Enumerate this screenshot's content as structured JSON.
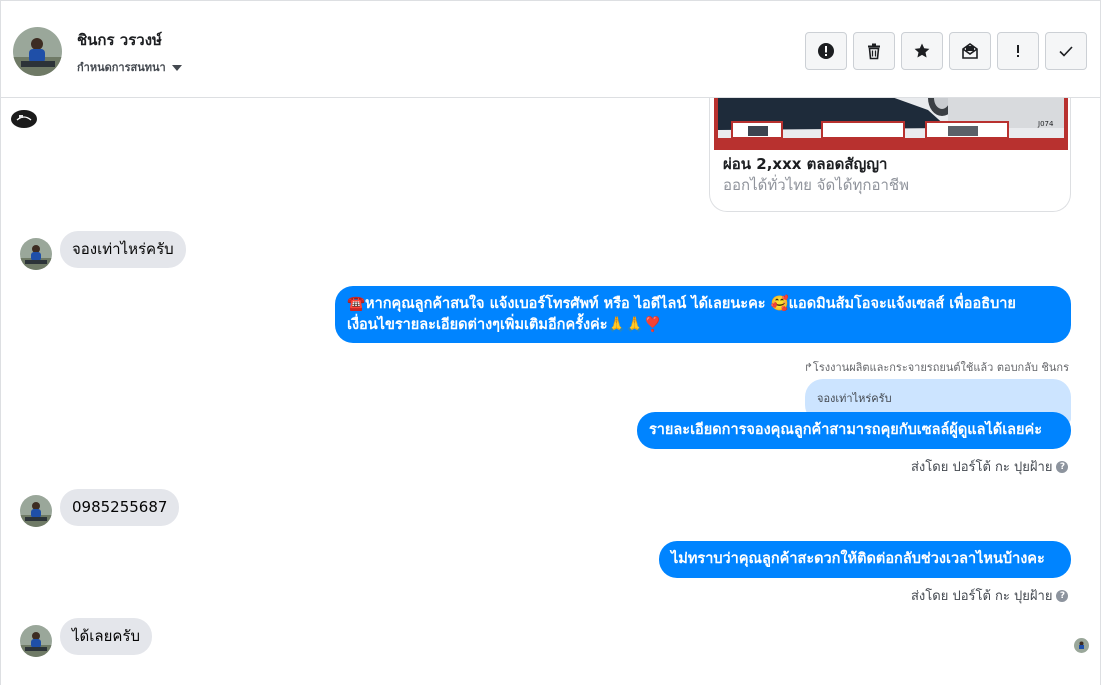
{
  "header": {
    "name": "ชินกร วรวงษ์",
    "subtitle": "กำหนดการสนทนา"
  },
  "actions": [
    {
      "name": "report-icon",
      "glyph": "!"
    },
    {
      "name": "trash-icon",
      "glyph": ""
    },
    {
      "name": "star-icon",
      "glyph": ""
    },
    {
      "name": "mark-unread-icon",
      "glyph": ""
    },
    {
      "name": "spam-icon",
      "glyph": "!"
    },
    {
      "name": "check-icon",
      "glyph": ""
    }
  ],
  "card": {
    "title": "ผ่อน 2,xxx ตลอดสัญญา",
    "subtitle": "ออกได้ทั่วไทย จัดได้ทุกอาชีพ",
    "image_tag": "J074"
  },
  "messages": {
    "in_1": "จองเท่าไหร่ครับ",
    "out_1_line1": "☎️หากคุณลูกค้าสนใจ แจ้งเบอร์โทรศัพท์ หรือ ไอดีไลน์  ได้เลยนะคะ 🥰แอดมินส้มโอจะแจ้งเซลส์   เพื่ออธิบาย",
    "out_1_line2": "เงื่อนไขรายละเอียดต่างๆเพิ่มเติมอีกครั้งค่ะ🙏🙏❣️",
    "reply_label": "↱โรงงานผลิตและกระจายรถยนต์ใช้แล้ว ตอบกลับ ชินกร",
    "quoted": "จองเท่าไหร่ครับ",
    "out_2": "รายละเอียดการจองคุณลูกค้าสามารถคุยกับเซลล์ผู้ดูแลได้เลยค่ะ",
    "sent_by_1": "ส่งโดย ปอร์โต้ กะ ปุยฝ้าย",
    "in_2": "0985255687",
    "out_3": "ไม่ทราบว่าคุณลูกค้าสะดวกให้ติดต่อกลับช่วงเวลาไหนบ้างคะ",
    "sent_by_2": "ส่งโดย ปอร์โต้ กะ ปุยฝ้าย",
    "in_3": "ได้เลยครับ"
  },
  "colors": {
    "outgoing": "#0084ff",
    "incoming": "#e4e6eb",
    "quoted": "#cce4ff"
  }
}
